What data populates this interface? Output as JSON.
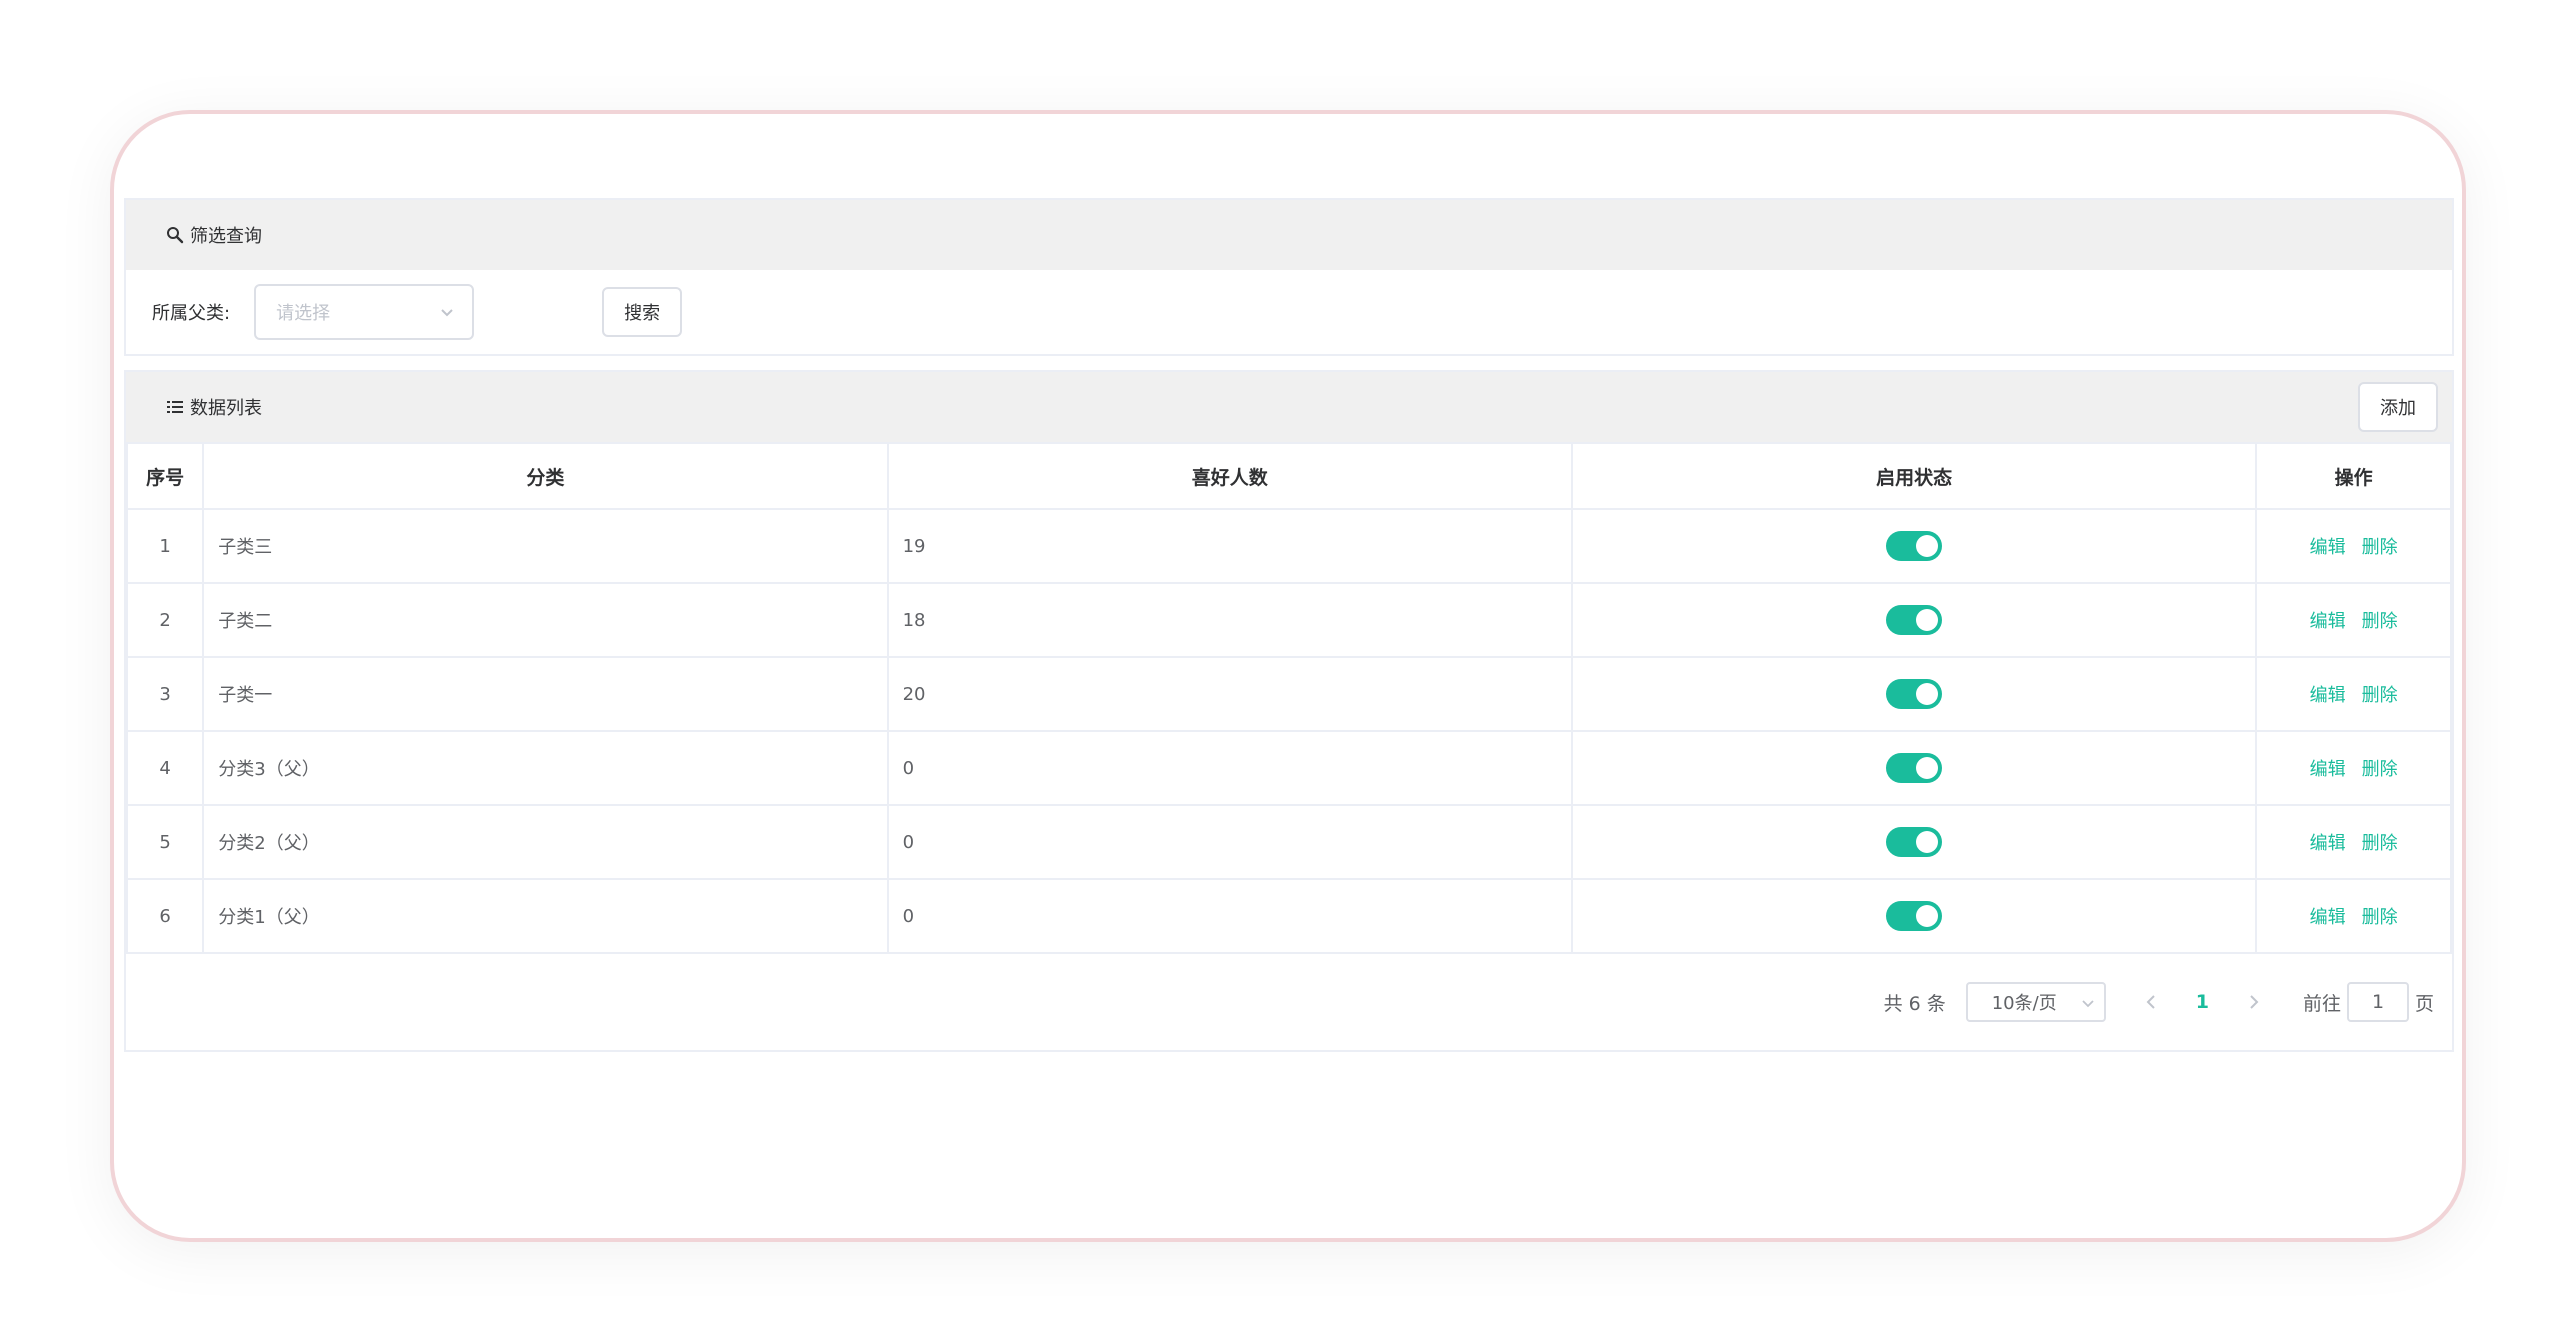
{
  "filter": {
    "title": "筛选查询",
    "parent_label": "所属父类:",
    "parent_placeholder": "请选择",
    "search_label": "搜索"
  },
  "list": {
    "title": "数据列表",
    "add_label": "添加",
    "columns": [
      "序号",
      "分类",
      "喜好人数",
      "启用状态",
      "操作"
    ],
    "rows": [
      {
        "index": "1",
        "name": "子类三",
        "likes": "19",
        "enabled": true
      },
      {
        "index": "2",
        "name": "子类二",
        "likes": "18",
        "enabled": true
      },
      {
        "index": "3",
        "name": "子类一",
        "likes": "20",
        "enabled": true
      },
      {
        "index": "4",
        "name": "分类3（父）",
        "likes": "0",
        "enabled": true
      },
      {
        "index": "5",
        "name": "分类2（父）",
        "likes": "0",
        "enabled": true
      },
      {
        "index": "6",
        "name": "分类1（父）",
        "likes": "0",
        "enabled": true
      }
    ],
    "edit_label": "编辑",
    "delete_label": "删除"
  },
  "pagination": {
    "total_label": "共 6 条",
    "page_size": "10条/页",
    "current_page": "1",
    "goto_label": "前往",
    "goto_value": "1",
    "page_suffix": "页"
  },
  "colors": {
    "accent": "#1abc9c",
    "frame_border": "#f1d4d7",
    "panel_header": "#f0f0f0"
  }
}
